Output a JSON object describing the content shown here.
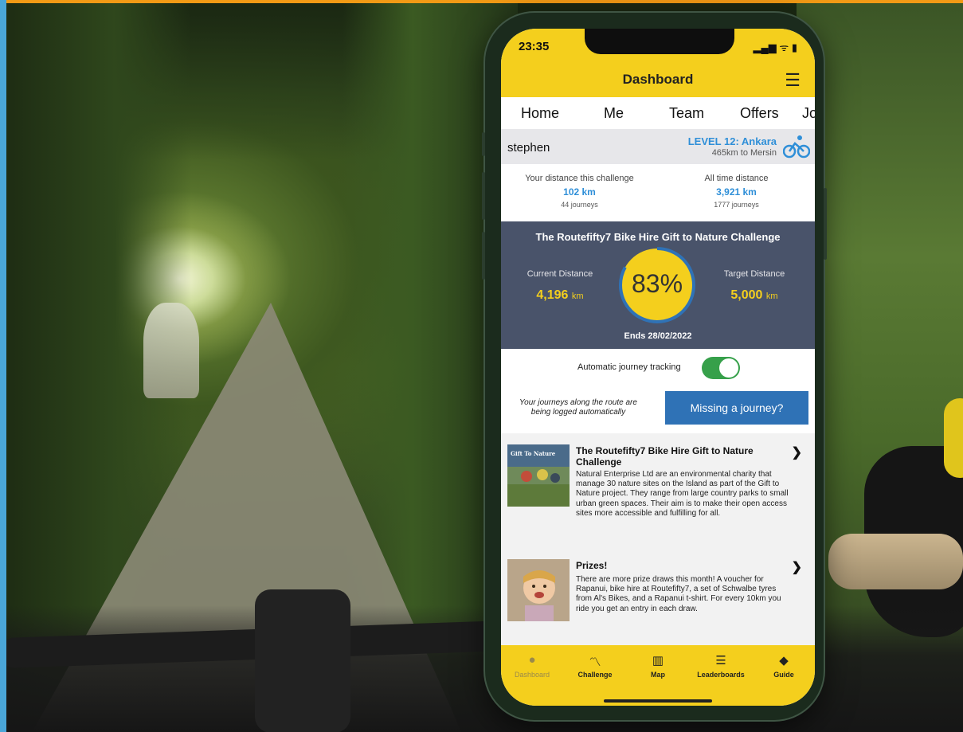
{
  "status_bar": {
    "time": "23:35",
    "indicators": "▂▄▆ ᯤ ▮"
  },
  "app_bar": {
    "title": "Dashboard",
    "menu_icon": "hamburger-icon"
  },
  "tabs": [
    "Home",
    "Me",
    "Team",
    "Offers",
    "Jo"
  ],
  "user": {
    "name": "stephen",
    "level": "LEVEL 12: Ankara",
    "next": "465km to Mersin"
  },
  "stats": {
    "challenge_label": "Your distance this challenge",
    "challenge_value": "102 km",
    "challenge_journeys": "44 journeys",
    "alltime_label": "All time distance",
    "alltime_value": "3,921 km",
    "alltime_journeys": "1777 journeys"
  },
  "challenge": {
    "title": "The Routefifty7 Bike Hire Gift to Nature Challenge",
    "current_label": "Current Distance",
    "current_value": "4,196",
    "target_label": "Target Distance",
    "target_value": "5,000",
    "unit": "km",
    "percent_text": "83%",
    "progress": 0.83,
    "ends": "Ends 28/02/2022"
  },
  "tracking": {
    "label": "Automatic journey tracking",
    "enabled": true
  },
  "missing": {
    "note": "Your journeys along the route are being logged automatically",
    "button": "Missing a journey?"
  },
  "feed": [
    {
      "title": "The Routefifty7 Bike Hire Gift to Nature Challenge",
      "thumb_text": "Gift To Nature",
      "body": "Natural Enterprise Ltd are an environmental charity that manage 30 nature sites on the Island as part of the Gift to Nature project. They range from large country parks to small urban green spaces. Their aim is to make their open access sites more accessible and fulfilling for all."
    },
    {
      "title": "Prizes!",
      "body": "There are more prize draws this month! A voucher for Rapanui, bike hire at Routefifty7, a set of Schwalbe tyres from Al's Bikes, and a Rapanui t-shirt. For every 10km you ride you get an entry in each draw."
    }
  ],
  "bottom_nav": [
    {
      "label": "Dashboard",
      "icon": "person-icon",
      "glyph": "●",
      "active": true
    },
    {
      "label": "Challenge",
      "icon": "trend-icon",
      "glyph": "〽",
      "active": false
    },
    {
      "label": "Map",
      "icon": "map-icon",
      "glyph": "▥",
      "active": false
    },
    {
      "label": "Leaderboards",
      "icon": "list-icon",
      "glyph": "☰",
      "active": false
    },
    {
      "label": "Guide",
      "icon": "direction-icon",
      "glyph": "◆",
      "active": false
    }
  ],
  "colors": {
    "brand_yellow": "#f4cf1d",
    "challenge_bg": "#49536a",
    "link_blue": "#2f8fd8",
    "button_blue": "#2f72b6",
    "toggle_green": "#36a04a"
  }
}
